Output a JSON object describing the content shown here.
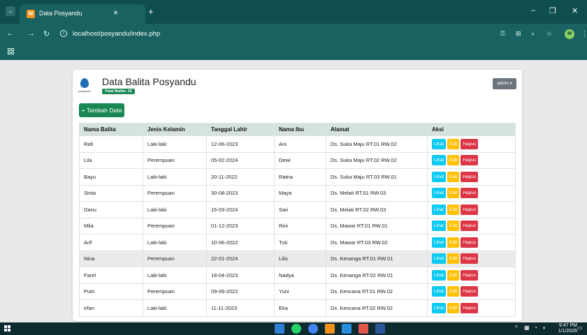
{
  "browser": {
    "tab_title": "Data Posyandu",
    "tab_favicon": "M",
    "url": "localhost/posyandu/index.php",
    "profile_initial": "M",
    "accent": "#1a6262"
  },
  "page": {
    "logo_text": "posyandu",
    "title": "Data Balita Posyandu",
    "total_badge": "Total Balita: 15",
    "user_menu": "admin ▾",
    "add_button": "+ Tambah Data"
  },
  "table": {
    "headers": [
      "Nama Balita",
      "Jenis Kelamin",
      "Tanggal Lahir",
      "Nama Ibu",
      "Alamat",
      "Aksi"
    ],
    "actions": {
      "view": "Lihat",
      "edit": "Edit",
      "delete": "Hapus"
    },
    "rows": [
      [
        "Rafi",
        "Laki-laki",
        "12-06-2023",
        "Ani",
        "Ds. Suka Maju RT.01 RW.02"
      ],
      [
        "Lila",
        "Perempuan",
        "05-02-2024",
        "Dewi",
        "Ds. Suka Maju RT.02 RW.02"
      ],
      [
        "Bayu",
        "Laki-laki",
        "20-11-2022",
        "Ratna",
        "Ds. Suka Maju RT.03 RW.01"
      ],
      [
        "Sinta",
        "Perempuan",
        "30-08-2023",
        "Maya",
        "Ds. Melati RT.01 RW.03"
      ],
      [
        "Danu",
        "Laki-laki",
        "15-03-2024",
        "Sari",
        "Ds. Melati RT.02 RW.03"
      ],
      [
        "Mila",
        "Perempuan",
        "01-12-2023",
        "Rini",
        "Ds. Mawar RT.01 RW.01"
      ],
      [
        "Arif",
        "Laki-laki",
        "10-06-2022",
        "Tuti",
        "Ds. Mawar RT.03 RW.02"
      ],
      [
        "Nina",
        "Perempuan",
        "22-01-2024",
        "Lilis",
        "Ds. Kenanga RT.01 RW.01"
      ],
      [
        "Farel",
        "Laki-laki",
        "18-04-2023",
        "Nadya",
        "Ds. Kenanga RT.02 RW.01"
      ],
      [
        "Putri",
        "Perempuan",
        "09-09-2022",
        "Yuni",
        "Ds. Kencana RT.01 RW.02"
      ],
      [
        "Irfan",
        "Laki-laki",
        "11-11-2023",
        "Eka",
        "Ds. Kencana RT.02 RW.02"
      ]
    ]
  },
  "taskbar": {
    "time": "9:47 PM",
    "date": "1/1/2026"
  }
}
